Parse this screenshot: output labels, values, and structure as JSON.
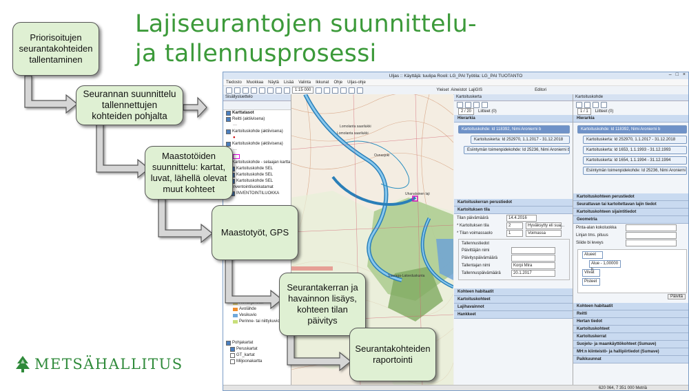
{
  "slide": {
    "title_line1": "Lajiseurantojen suunnittelu-",
    "title_line2": "ja tallennusprosessi"
  },
  "steps": [
    "Priorisoitujen seurantakohteiden tallentaminen",
    "Seurannan suunnittelu tallennettujen kohteiden pohjalta",
    "Maastotöiden suunnittelu: kartat, luvat, lähellä olevat muut kohteet",
    "Maastotyöt, GPS",
    "Seurantakerran ja havainnon lisäys, kohteen tilan päivitys",
    "Seurantakohteiden raportointi"
  ],
  "logo": {
    "text": "METSÄHALLITUS"
  },
  "app": {
    "window_title": "Uljas :: Käyttäjä: tuulipa  Rooli: LG_PAI  Työtila: LG_PAI TUOTANTO",
    "menu": [
      "Tiedosto",
      "Muokkaa",
      "Näytä",
      "Lisää",
      "Valinta",
      "Ikkunat",
      "Ohje",
      "Uljas-ohje"
    ],
    "scale": "1:15 000",
    "toolbar_right": [
      "Yleiset",
      "Aineistot",
      "LajiGIS",
      "Editori"
    ],
    "toc": {
      "title": "Sisällysluettelo",
      "root": "Karttatasot",
      "items": [
        "Reitti (aktiivisena)",
        "Kartoituskohde (aktiivisena)",
        "Kartoituskohde (aktiivisena)",
        "Kartoituskohde - selaajan kartta",
        "Kartoituskohde SEL",
        "Kartoituskohde SEL",
        "Kartoituskohde SEL",
        "Inventointiluokkatamat",
        "INVENTOINTILUOKKA"
      ],
      "legend": [
        "Nevat ja letot",
        "Avolähde",
        "Vesikuvio",
        "Perinne- tai niittykuvio"
      ],
      "bottom": [
        "Pohjakartat",
        "Peruskartat",
        "GT_kartat",
        "Miljoonakartta"
      ]
    },
    "map_labels": [
      "Lomolanta saarilukki",
      "Lomolanta saarilukki",
      "Ounasjoki",
      "Uhanalainen laji",
      "Saaraga-Latoeduskunta"
    ],
    "visit_panel": {
      "title": "Kartoituskerta",
      "counter": "2 / 20",
      "attachments": "Liitteet (0)",
      "hier_title": "Hierarkia",
      "hier": [
        "Kartoituskohde: Id 118392, Nimi Aronierni b",
        "Kartoituskerta: Id 252970, 1.1.2017 - 31.12.2018",
        "Esiintymän toimenpidekohde: Id 25236, Nimi Aronierni b"
      ],
      "sections": [
        "Kartoituskerran perustiedot",
        "Kartoituksen tila"
      ],
      "fields": [
        {
          "label": "Tilan päivämäärä",
          "value": "14.4.2016"
        },
        {
          "label": "* Kartoituksen tila",
          "value": "2"
        },
        {
          "label": "* Tilan voimassaolo",
          "value": "1"
        }
      ],
      "field_extras": [
        "Hyväksytty eli sua...",
        "Voimassa"
      ],
      "subsection": "Tallennustiedot",
      "fields2": [
        {
          "label": "Päivittäjän nimi",
          "value": ""
        },
        {
          "label": "Päivityspäivämäärä",
          "value": ""
        },
        {
          "label": "Tallentajan nimi",
          "value": "Korpi Mira"
        },
        {
          "label": "Tallennuspäivämäärä",
          "value": "20.1.2017"
        }
      ],
      "bottom_sections": [
        "Kohteen habitaatit",
        "Kartoituskohteet",
        "Lajihavainnot",
        "Hankkeet"
      ]
    },
    "target_panel": {
      "title": "Kartoituskohde",
      "counter": "1 / 1",
      "attachments": "Liitteet (0)",
      "hier_title": "Hierarkia",
      "hier": [
        "Kartoituskohde: Id 118392, Nimi Aronierni b",
        "Kartoituskerta: Id 252970, 1.1.2017 - 31.12.2018",
        "Kartoituskerta: Id 1653, 1.1.1993 - 31.12.1993",
        "Kartoituskerta: Id 1654, 1.1.1994 - 31.12.1994",
        "Esiintymän toimenpidekohde: Id 25236, Nimi Aronierni b"
      ],
      "sections": [
        "Kartoituskohteen perustiedot",
        "Seurattavan tai kartoitettavan lajin tiedot",
        "Kartoituskohteen sijaintitiedot",
        "Geometria"
      ],
      "geom_fields": [
        "Pinta-alan kokoluokka",
        "Linjan tms. pituus",
        "Siiide bi leveys"
      ],
      "tree": [
        "Alueet",
        "Alue - 1,00000 h",
        "Viivat",
        "Pisteet"
      ],
      "button": "Päivitä",
      "bottom_sections": [
        "Kohteen habitaatit",
        "Reitti",
        "Hertan tiedot",
        "Kartoituskohteet",
        "Kartoituskerrat",
        "Suojelu- ja maankäyttökohteet (Sumave)",
        "MH:n kiinteistö- ja hallipiirtiedot (Sumave)",
        "Paikkuunnat"
      ]
    },
    "status": "620 064, 7 351 000 Metriä"
  }
}
